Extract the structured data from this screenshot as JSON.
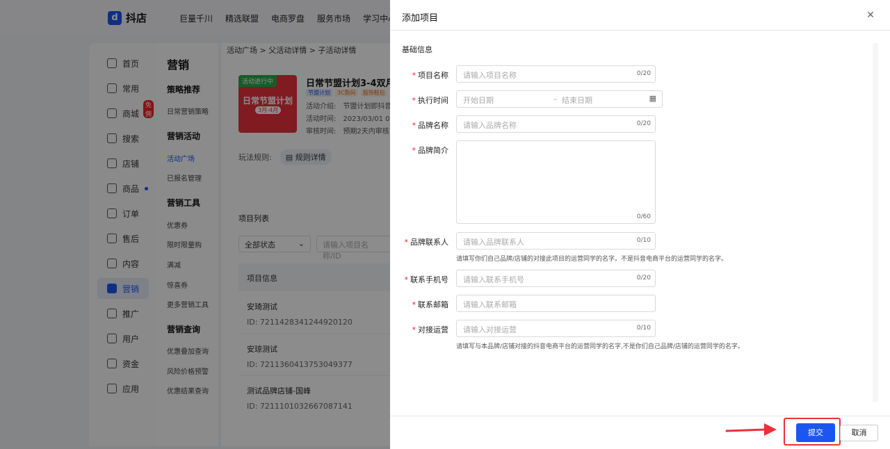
{
  "topbar": {
    "logo": "抖店",
    "nav": [
      "巨量千川",
      "精选联盟",
      "电商罗盘",
      "服务市场",
      "学习中心"
    ]
  },
  "leftnav": {
    "items": [
      {
        "label": "首页"
      },
      {
        "label": "常用"
      },
      {
        "label": "商城",
        "badge": "免佣"
      },
      {
        "label": "搜索"
      },
      {
        "label": "店铺"
      },
      {
        "label": "商品"
      },
      {
        "label": "订单"
      },
      {
        "label": "售后"
      },
      {
        "label": "内容"
      },
      {
        "label": "营销"
      },
      {
        "label": "推广"
      },
      {
        "label": "用户"
      },
      {
        "label": "资金"
      },
      {
        "label": "应用"
      }
    ]
  },
  "subnav": {
    "title": "营销",
    "groups": [
      {
        "head": "策略推荐",
        "items": [
          "日常营销策略"
        ]
      },
      {
        "head": "营销活动",
        "items": [
          "活动广场",
          "已报名管理"
        ]
      },
      {
        "head": "营销工具",
        "items": [
          "优惠券",
          "限时限量购",
          "满减",
          "惊喜券",
          "更多营销工具"
        ]
      },
      {
        "head": "营销查询",
        "items": [
          "优惠叠加查询",
          "风险价格预警",
          "优惠结果查询"
        ]
      }
    ]
  },
  "main": {
    "breadcrumb": "活动广场 > 父活动详情 > 子活动详情",
    "promo": {
      "status": "活动进行中",
      "big": "日常节盟计划",
      "small": "3月-4月"
    },
    "activity_title": "日常节盟计划3-4双月",
    "tags": [
      "节盟计划",
      "3C数码",
      "服饰鞋包"
    ],
    "intro": "活动介绍:　节盟计划即抖音",
    "time": "活动时间:　2023/03/01 00:",
    "review": "审核时间:　预期2天内审核",
    "rules_label": "玩法规则:",
    "rules_button": "规则详情",
    "list_title": "项目列表",
    "status_filter": "全部状态",
    "search_placeholder": "请输入项目名称/ID",
    "table_header": "项目信息",
    "rows": [
      {
        "name": "安琦测试",
        "id": "ID:  7211428341244920120"
      },
      {
        "name": "安琼测试",
        "id": "ID:  7211360413753049377"
      },
      {
        "name": "测试品牌店铺-国峰",
        "id": "ID:  7211101032667087141"
      }
    ]
  },
  "drawer": {
    "title": "添加项目",
    "section": "基础信息",
    "fields": {
      "name": {
        "label": "项目名称",
        "placeholder": "请输入项目名称",
        "counter": "0/20"
      },
      "time": {
        "label": "执行时间",
        "start": "开始日期",
        "sep": "–",
        "end": "结束日期"
      },
      "brand": {
        "label": "品牌名称",
        "placeholder": "请输入品牌名称",
        "counter": "0/20"
      },
      "intro": {
        "label": "品牌简介",
        "counter": "0/60"
      },
      "contact": {
        "label": "品牌联系人",
        "placeholder": "请输入品牌联系人",
        "counter": "0/10",
        "hint": "请填写你们自己品牌/店铺的对接此项目的运营同学的名字。不是抖音电商平台的运营同学的名字。"
      },
      "phone": {
        "label": "联系手机号",
        "placeholder": "请输入联系手机号",
        "counter": "0/20"
      },
      "email": {
        "label": "联系邮箱",
        "placeholder": "请输入联系邮箱"
      },
      "operator": {
        "label": "对接运营",
        "placeholder": "请输入对接运营",
        "counter": "0/10",
        "hint": "请填写与本品牌/店铺对接的抖音电商平台的运营同学的名字,不是你们自己品牌/店铺的运营同学的名字。"
      }
    },
    "submit": "提交",
    "cancel": "取消"
  },
  "colors": {
    "primary": "#1c56f0",
    "required": "#f5222d",
    "highlight": "#e8323c"
  }
}
